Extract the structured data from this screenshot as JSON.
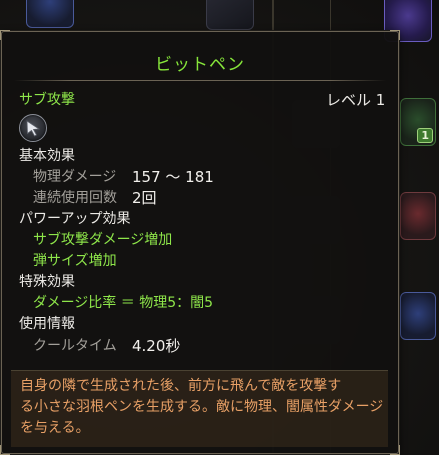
{
  "tooltip": {
    "title": "ビットペン",
    "type_label": "サブ攻撃",
    "level_label": "レベル 1",
    "skill_icon": "pen-cursor-icon",
    "basic_effects": {
      "heading": "基本効果",
      "physical_damage_label": "物理ダメージ",
      "physical_damage_value": "157 ～ 181",
      "consecutive_uses_label": "連続使用回数",
      "consecutive_uses_value": "2回"
    },
    "powerup_effects": {
      "heading": "パワーアップ効果",
      "items": [
        "サブ攻撃ダメージ増加",
        "弾サイズ増加"
      ]
    },
    "special_effects": {
      "heading": "特殊効果",
      "text": "ダメージ比率 ＝ 物理5：闇5"
    },
    "usage_info": {
      "heading": "使用情報",
      "cooldown_label": "クールタイム",
      "cooldown_value": "4.20秒"
    },
    "description": "自身の隣で生成された後、前方に飛んで敵を攻撃す\nる小さな羽根ペンを生成する。敵に物理、闇属性ダメージ\nを与える。"
  },
  "background": {
    "slot_badge": "1"
  },
  "colors": {
    "title_green": "#86e53a",
    "effect_green": "#8ee64a",
    "description_orange": "#e8a066",
    "border": "#6b6354"
  }
}
